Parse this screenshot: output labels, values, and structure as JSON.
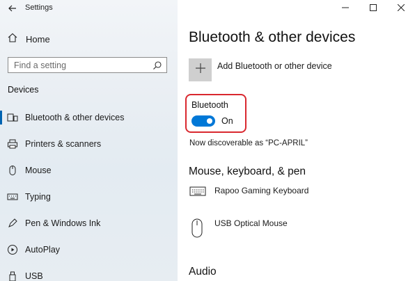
{
  "window": {
    "title": "Settings",
    "controls": [
      "minimize",
      "maximize",
      "close"
    ]
  },
  "sidebar": {
    "home_label": "Home",
    "search_placeholder": "Find a setting",
    "section_header": "Devices",
    "items": [
      {
        "label": "Bluetooth & other devices",
        "icon": "bluetooth-devices-icon",
        "active": true
      },
      {
        "label": "Printers & scanners",
        "icon": "printer-icon",
        "active": false
      },
      {
        "label": "Mouse",
        "icon": "mouse-icon",
        "active": false
      },
      {
        "label": "Typing",
        "icon": "keyboard-icon",
        "active": false
      },
      {
        "label": "Pen & Windows Ink",
        "icon": "pen-icon",
        "active": false
      },
      {
        "label": "AutoPlay",
        "icon": "autoplay-icon",
        "active": false
      },
      {
        "label": "USB",
        "icon": "usb-icon",
        "active": false
      }
    ]
  },
  "main": {
    "title": "Bluetooth & other devices",
    "add_device_label": "Add Bluetooth or other device",
    "bluetooth": {
      "label": "Bluetooth",
      "state": "On",
      "enabled": true
    },
    "discoverable_text": "Now discoverable as “PC-APRIL”",
    "mkp_header": "Mouse, keyboard, & pen",
    "devices": [
      {
        "name": "Rapoo Gaming Keyboard",
        "icon": "keyboard-icon"
      },
      {
        "name": "USB Optical Mouse",
        "icon": "mouse-icon"
      }
    ],
    "audio_header": "Audio"
  },
  "colors": {
    "accent": "#0078d7",
    "highlight_border": "#d9282f",
    "sidebar_bg": "#eaeff4"
  }
}
